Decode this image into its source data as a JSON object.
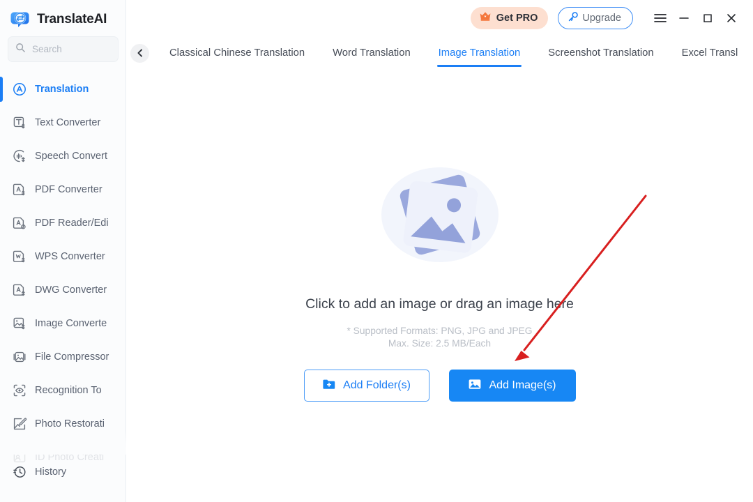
{
  "app": {
    "name": "TranslateAI",
    "logo_icon": "translate-bubble-logo"
  },
  "sidebar": {
    "search": {
      "placeholder": "Search",
      "value": "",
      "icon": "search-icon"
    },
    "items": [
      {
        "label": "Translation",
        "icon": "translation-icon",
        "active": true,
        "faded": false
      },
      {
        "label": "Text Converter",
        "icon": "text-converter-icon",
        "active": false,
        "faded": false
      },
      {
        "label": "Speech Convert",
        "icon": "speech-convert-icon",
        "active": false,
        "faded": false
      },
      {
        "label": "PDF Converter",
        "icon": "pdf-converter-icon",
        "active": false,
        "faded": false
      },
      {
        "label": "PDF Reader/Edi",
        "icon": "pdf-reader-editor-icon",
        "active": false,
        "faded": false
      },
      {
        "label": "WPS Converter",
        "icon": "wps-converter-icon",
        "active": false,
        "faded": false
      },
      {
        "label": "DWG Converter",
        "icon": "dwg-converter-icon",
        "active": false,
        "faded": false
      },
      {
        "label": "Image Converte",
        "icon": "image-converter-icon",
        "active": false,
        "faded": false
      },
      {
        "label": "File Compressor",
        "icon": "file-compressor-icon",
        "active": false,
        "faded": false
      },
      {
        "label": "Recognition To",
        "icon": "recognition-icon",
        "active": false,
        "faded": false
      },
      {
        "label": "Photo Restorati",
        "icon": "photo-restoration-icon",
        "active": false,
        "faded": false
      },
      {
        "label": "ID Photo Creati",
        "icon": "id-photo-icon",
        "active": false,
        "faded": true
      }
    ],
    "bottom_item": {
      "label": "History",
      "icon": "history-icon"
    }
  },
  "titlebar": {
    "get_pro": {
      "label": "Get PRO",
      "icon": "crown-icon"
    },
    "upgrade": {
      "label": "Upgrade",
      "icon": "key-icon"
    },
    "menu_icon": "hamburger-menu-icon",
    "minimize_icon": "minimize-icon",
    "maximize_icon": "maximize-icon",
    "close_icon": "close-icon"
  },
  "tabbar": {
    "back_icon": "chevron-left-icon",
    "tabs": [
      {
        "label": "Classical Chinese Translation",
        "active": false
      },
      {
        "label": "Word Translation",
        "active": false
      },
      {
        "label": "Image Translation",
        "active": true
      },
      {
        "label": "Screenshot Translation",
        "active": false
      },
      {
        "label": "Excel Transl",
        "active": false
      }
    ]
  },
  "main": {
    "illustration_icon": "image-placeholder-illustration",
    "drop_title": "Click to add an image or drag an image here",
    "supported_formats": "* Supported Formats: PNG, JPG and JPEG",
    "max_size": "Max. Size: 2.5 MB/Each",
    "add_folder": {
      "label": "Add Folder(s)",
      "icon": "folder-plus-icon"
    },
    "add_image": {
      "label": "Add Image(s)",
      "icon": "image-icon"
    }
  },
  "annotation": {
    "arrow_icon": "red-arrow-pointing-to-add-image-button",
    "color": "#d81f1f"
  },
  "colors": {
    "accent": "#1b7ef5",
    "primary_button": "#1787f4",
    "pro_badge_bg": "#fddfd0",
    "crown": "#f4763a",
    "sidebar_bg": "#fbfcfd",
    "illustration": "#9aa8dd"
  }
}
